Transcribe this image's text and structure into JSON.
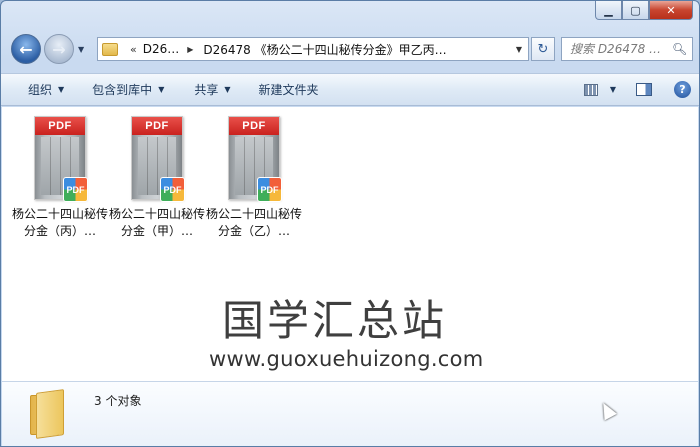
{
  "window": {
    "minimize_glyph": "▁",
    "maximize_glyph": "▢",
    "close_glyph": "✕"
  },
  "navigation": {
    "back_glyph": "←",
    "forward_glyph": "→",
    "history_glyph": "▼"
  },
  "address": {
    "overflow_glyph": "«",
    "crumb_parent": "D26…",
    "crumb_current": "D26478 《杨公二十四山秘传分金》甲乙丙…",
    "dropdown_glyph": "▼",
    "refresh_glyph": "↻"
  },
  "search": {
    "placeholder": "搜索 D26478 …",
    "icon": "search-icon"
  },
  "toolbar": {
    "organize": "组织",
    "include_in_library": "包含到库中",
    "share": "共享",
    "new_folder": "新建文件夹",
    "help_glyph": "?"
  },
  "files": [
    {
      "type_label": "PDF",
      "badge": "PDF",
      "name": "杨公二十四山秘传分金（丙）…"
    },
    {
      "type_label": "PDF",
      "badge": "PDF",
      "name": "杨公二十四山秘传分金（甲）…"
    },
    {
      "type_label": "PDF",
      "badge": "PDF",
      "name": "杨公二十四山秘传分金（乙）…"
    }
  ],
  "watermark": {
    "cn": "国学汇总站",
    "url": "www.guoxuehuizong.com"
  },
  "details": {
    "object_count": "3 个对象"
  },
  "colors": {
    "pdf_red": "#d8302a",
    "toolbar_text": "#1e395b",
    "close_button": "#c8452f"
  }
}
